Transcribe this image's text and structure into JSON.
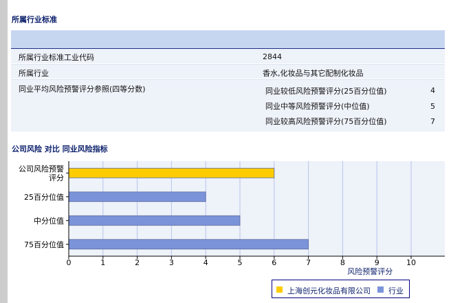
{
  "page": {
    "section_title": "所属行业标准",
    "chart_section_title": "公司风险 对比 同业风险指标"
  },
  "table": {
    "sic_label": "所属行业标准工业代码",
    "sic_value": "2844",
    "industry_label": "所属行业",
    "industry_value": "香水,化妆品与其它配制化妆品",
    "avg_label": "同业平均风险预警评分参照(四等分数)",
    "percentiles": [
      {
        "label": "同业较低风险预警评分(25百分位值)",
        "value": "4"
      },
      {
        "label": "同业中等风险预警评分(中位值)",
        "value": "5"
      },
      {
        "label": "同业较高风险预警评分(75百分位值)",
        "value": "7"
      }
    ]
  },
  "colors": {
    "company": "#ffcc00",
    "industry": "#7b93d9",
    "header_band": "#c6d6f1",
    "row_bg": "#eef2f9",
    "plot_bg": "#eef2f9",
    "grid": "#b8c4ec"
  },
  "chart_data": {
    "type": "bar",
    "orientation": "horizontal",
    "categories": [
      "公司风险预警评分",
      "25百分位值",
      "中分位值",
      "75百分位值"
    ],
    "category_lines": [
      [
        "公司风险预警",
        "评分"
      ],
      [
        "25百分位值"
      ],
      [
        "中分位值"
      ],
      [
        "75百分位值"
      ]
    ],
    "series": [
      {
        "name": "上海创元化妆品有限公司",
        "values": [
          6,
          null,
          null,
          null
        ],
        "color": "#ffcc00"
      },
      {
        "name": "行业",
        "values": [
          null,
          4,
          5,
          7
        ],
        "color": "#7b93d9"
      }
    ],
    "xlabel": "风险预警评分",
    "ylabel": "",
    "xlim": [
      0,
      11
    ],
    "xticks": [
      0,
      1,
      2,
      3,
      4,
      5,
      6,
      7,
      8,
      9,
      10
    ],
    "grid": true,
    "legend_position": "bottom-right"
  }
}
